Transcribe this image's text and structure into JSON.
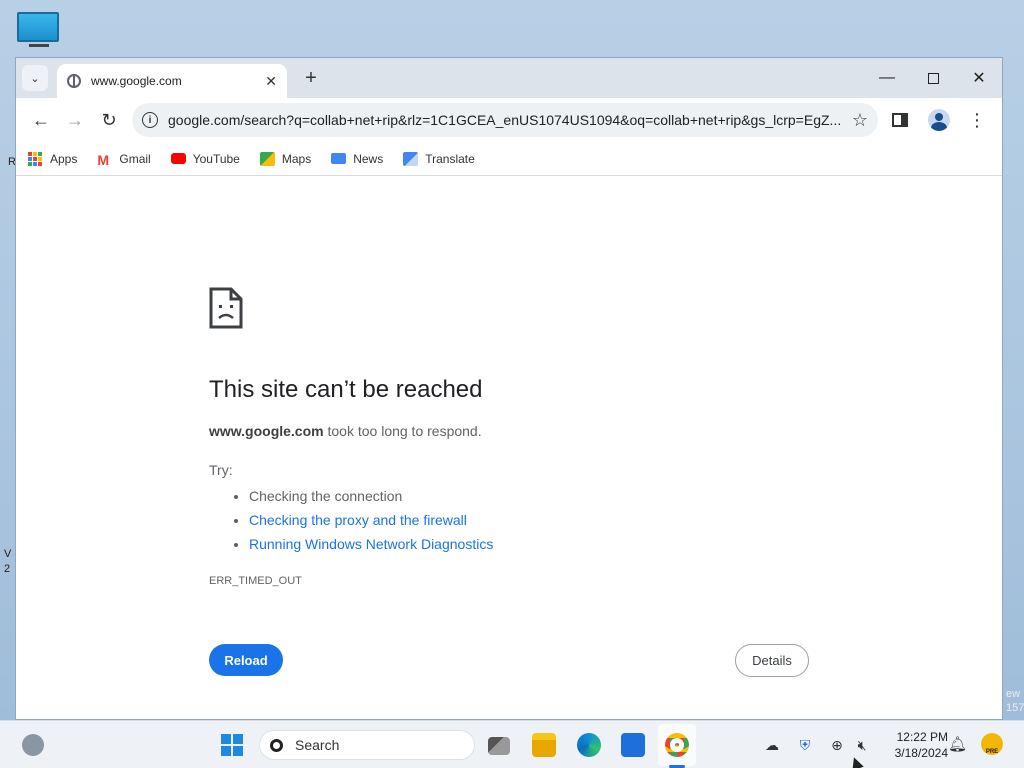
{
  "desktop": {
    "frag_left_1": "R",
    "frag_left_2": "V",
    "frag_left_3": "2",
    "frag_right_1": "ew",
    "frag_right_2": "157"
  },
  "browser": {
    "tab": {
      "title": "www.google.com",
      "close": "✕"
    },
    "new_tab": "+",
    "window_controls": {
      "minimize": "—",
      "close": "✕"
    },
    "nav": {
      "back": "←",
      "forward": "→",
      "reload": "↻"
    },
    "omnibox": {
      "info": "i",
      "url": "google.com/search?q=collab+net+rip&rlz=1C1GCEA_enUS1074US1094&oq=collab+net+rip&gs_lcrp=EgZ...",
      "star": "☆"
    },
    "menu": "⋮",
    "bookmarks": [
      {
        "label": "Apps",
        "icon": "apps-grid-icon"
      },
      {
        "label": "Gmail",
        "icon": "gmail-icon",
        "color": "#ea4335"
      },
      {
        "label": "YouTube",
        "icon": "youtube-icon",
        "color": "#ff0000"
      },
      {
        "label": "Maps",
        "icon": "maps-icon",
        "color": "#34a853"
      },
      {
        "label": "News",
        "icon": "news-icon",
        "color": "#4285f4"
      },
      {
        "label": "Translate",
        "icon": "translate-icon",
        "color": "#4285f4"
      }
    ]
  },
  "error_page": {
    "title": "This site can’t be reached",
    "host": "www.google.com",
    "desc_rest": " took too long to respond.",
    "try_label": "Try:",
    "suggestions": [
      "Checking the connection",
      "Checking the proxy and the firewall",
      "Running Windows Network Diagnostics"
    ],
    "error_code": "ERR_TIMED_OUT",
    "reload_label": "Reload",
    "details_label": "Details",
    "accent": "#1a73e8"
  },
  "taskbar": {
    "search_placeholder": "Search",
    "clock": {
      "time": "12:22 PM",
      "date": "3/18/2024"
    },
    "badge": "PRE"
  }
}
